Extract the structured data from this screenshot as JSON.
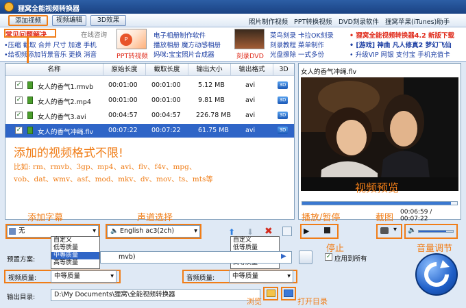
{
  "window": {
    "title": "狸窝全能视频转换器"
  },
  "menu": {
    "tabs": [
      "添加视频",
      "视频编辑",
      "3D效果"
    ],
    "right_links": [
      "照片制作视频",
      "PPT转换视频",
      "DVD刻录软件",
      "狸窝苹果(iTunes)助手"
    ]
  },
  "promo": {
    "faq_title": "常见问题解决",
    "online_consult": "在线咨询",
    "faq_line1": "•压缩  截取  合并  尺寸  加速  手机",
    "faq_line2": "•给视频添加背景音乐  更换  消音",
    "ppt_label": "PPT转视频",
    "links1": [
      "电子相册制作软件",
      "播放相册  魔方动感相册",
      "妈咪:宝宝照片合成器"
    ],
    "dvd_label": "刻录DVD",
    "links2": [
      "菜鸟刻录  卡拉OK刻录",
      "刻录教程  菜单制作",
      "光盘擦除  一式多份"
    ],
    "links3_line1": "• 狸窝全能视频转换器4.2  新版下载",
    "links3_line2": "• [游戏] 神曲  凡人修真2  梦幻飞仙",
    "links3_line3": "• 升级VIP  网银  支付宝  手机充值卡"
  },
  "list": {
    "headers": [
      "名称",
      "原始长度",
      "截取长度",
      "输出大小",
      "输出格式",
      "3D"
    ],
    "rows": [
      {
        "name": "女人的香气1.rmvb",
        "orig": "00:01:00",
        "cut": "00:01:00",
        "size": "5.12 MB",
        "fmt": "avi"
      },
      {
        "name": "女人的香气2.mp4",
        "orig": "00:01:00",
        "cut": "00:01:00",
        "size": "9.81 MB",
        "fmt": "avi"
      },
      {
        "name": "女人的香气3.avi",
        "orig": "00:04:57",
        "cut": "00:04:57",
        "size": "226.78 MB",
        "fmt": "avi"
      },
      {
        "name": "女人的香气冲绳.flv",
        "orig": "00:07:22",
        "cut": "00:07:22",
        "size": "61.75 MB",
        "fmt": "avi"
      }
    ],
    "badge_3d": "3D"
  },
  "annotations": {
    "formats_title": "添加的视频格式不限!",
    "formats_line1": "比如: rm、rmvb、3gp、mp4、avi、flv、f4v、mpg、",
    "formats_line2": "vob、dat、wmv、asf、mod、mkv、dv、mov、ts、mts等",
    "add_subtitle": "添加字幕",
    "audio_select": "声道选择",
    "play_pause": "播放/暂停",
    "screenshot": "截图",
    "stop": "停止",
    "volume": "音量调节",
    "preview": "视频预览",
    "browse": "浏览",
    "open_dir": "打开目录"
  },
  "preview": {
    "filename": "女人的香气冲绳.flv",
    "time": "00:06:59 / 00:07:22",
    "progress": 0.96,
    "volume": 0.8
  },
  "controls": {
    "subtitle_value": "无",
    "audio_value": "English ac3(2ch)",
    "preset_label": "预置方案:",
    "preset_value": "mvb)",
    "video_quality_label": "视频质量:",
    "video_quality_value": "中等质量",
    "audio_quality_label": "音频质量:",
    "audio_quality_value": "中等质量",
    "apply_all": "应用到所有",
    "output_label": "输出目录:",
    "output_path": "D:\\My Documents\\狸窝\\全能视频转换器"
  },
  "quality_options": [
    "自定义",
    "低等质量",
    "中等质量",
    "高等质量"
  ],
  "colors": {
    "accent": "#f07d17",
    "selection": "#2f65c7",
    "title_bar": "#1a4283"
  }
}
